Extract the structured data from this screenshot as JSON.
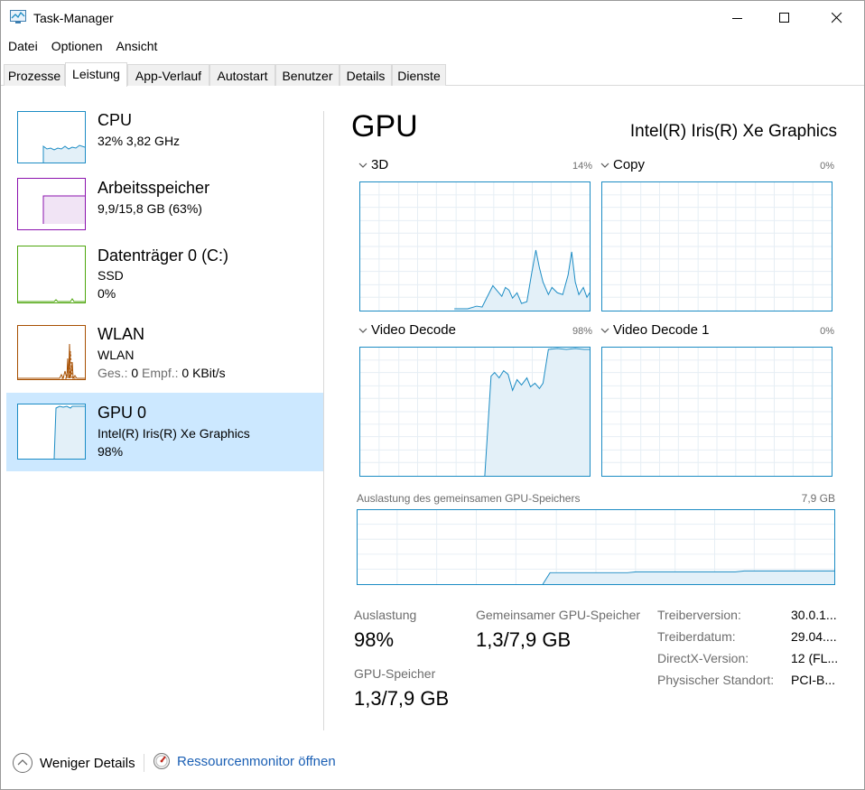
{
  "window": {
    "title": "Task-Manager",
    "icon": "task-manager-icon",
    "controls": [
      "minimize-icon",
      "maximize-icon",
      "close-icon"
    ]
  },
  "menu": [
    "Datei",
    "Optionen",
    "Ansicht"
  ],
  "tabs": [
    "Prozesse",
    "Leistung",
    "App-Verlauf",
    "Autostart",
    "Benutzer",
    "Details",
    "Dienste"
  ],
  "active_tab": "Leistung",
  "colors": {
    "cpu": "#1c8cc4",
    "memory": "#8b12ae",
    "disk": "#4da60c",
    "wlan": "#a74f01",
    "gpu": "#1c8cc4",
    "selected_bg": "#cce8ff",
    "link": "#1a5fb4"
  },
  "resources": [
    {
      "name": "CPU",
      "line1": "32% 3,82 GHz",
      "line2": ""
    },
    {
      "name": "Arbeitsspeicher",
      "line1": "9,9/15,8 GB (63%)",
      "line2": ""
    },
    {
      "name": "Datenträger 0 (C:)",
      "line1": "SSD",
      "line2": "0%"
    },
    {
      "name": "WLAN",
      "line1": "WLAN",
      "line2_label_send": "Ges.:",
      "line2_send": "0",
      "line2_label_recv": "Empf.:",
      "line2_recv": "0 KBit/s"
    },
    {
      "name": "GPU 0",
      "line1": "Intel(R) Iris(R) Xe Graphics",
      "line2": "98%"
    }
  ],
  "selected_resource": "GPU 0",
  "gpu": {
    "title": "GPU",
    "model": "Intel(R) Iris(R) Xe Graphics",
    "engines": [
      {
        "name": "3D",
        "pct": "14%"
      },
      {
        "name": "Copy",
        "pct": "0%"
      },
      {
        "name": "Video Decode",
        "pct": "98%"
      },
      {
        "name": "Video Decode 1",
        "pct": "0%"
      }
    ],
    "shared_mem_label": "Auslastung des gemeinsamen GPU-Speichers",
    "shared_mem_max": "7,9 GB",
    "stats": {
      "utilization_label": "Auslastung",
      "utilization": "98%",
      "shared_label": "Gemeinsamer GPU-Speicher",
      "shared": "1,3/7,9 GB",
      "gpumem_label": "GPU-Speicher",
      "gpumem": "1,3/7,9 GB"
    },
    "properties": [
      {
        "label": "Treiberversion:",
        "value": "30.0.1..."
      },
      {
        "label": "Treiberdatum:",
        "value": "29.04...."
      },
      {
        "label": "DirectX-Version:",
        "value": "12 (FL..."
      },
      {
        "label": "Physischer Standort:",
        "value": "PCI-B..."
      }
    ]
  },
  "footer": {
    "fewer_details": "Weniger Details",
    "resource_monitor": "Ressourcenmonitor öffnen"
  }
}
